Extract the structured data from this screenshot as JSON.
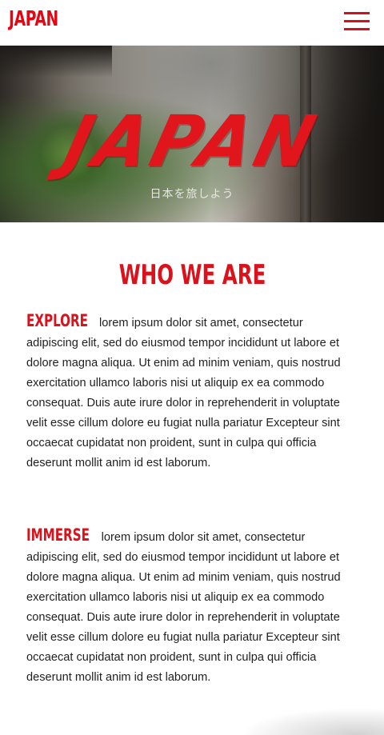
{
  "header": {
    "logo_text": "JAPAN",
    "menu_icon": "hamburger-menu-icon"
  },
  "hero": {
    "title": "JAPAN",
    "subtitle": "日本を旅しよう"
  },
  "about": {
    "title": "WHO WE ARE",
    "sections": [
      {
        "kicker": "EXPLORE",
        "body": "lorem ipsum dolor sit amet, consectetur adipiscing elit, sed do eiusmod tempor incididunt ut labore et dolore magna aliqua. Ut enim ad minim veniam, quis nostrud exercitation ullamco laboris nisi ut aliquip ex ea commodo consequat. Duis aute irure dolor in reprehenderit in voluptate velit esse cillum dolore eu fugiat nulla pariatur Excepteur sint occaecat cupidatat non proident, sunt in culpa qui officia deserunt mollit anim id est laborum."
      },
      {
        "kicker": "IMMERSE",
        "body": "lorem ipsum dolor sit amet, consectetur adipiscing elit, sed do eiusmod tempor incididunt ut labore et dolore magna aliqua. Ut enim ad minim veniam, quis nostrud exercitation ullamco laboris nisi ut aliquip ex ea commodo consequat. Duis aute irure dolor in reprehenderit in voluptate velit esse cillum dolore eu fugiat nulla pariatur Excepteur sint occaecat cupidatat non proident, sunt in culpa qui officia deserunt mollit anim id est laborum."
      }
    ]
  },
  "colors": {
    "brand_red": "#d9121c",
    "text": "#1f1f1f",
    "background": "#ffffff"
  }
}
